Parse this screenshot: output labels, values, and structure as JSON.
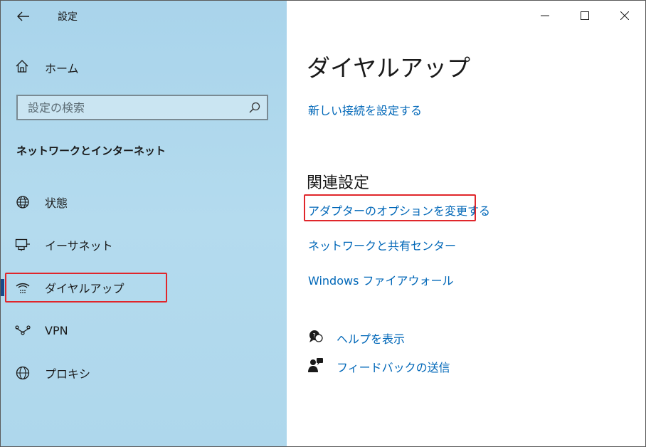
{
  "window": {
    "app_title": "設定",
    "controls": {
      "minimize": "—",
      "maximize": "☐",
      "close": "✕"
    }
  },
  "sidebar": {
    "home_label": "ホーム",
    "search_placeholder": "設定の検索",
    "section_title": "ネットワークとインターネット",
    "items": [
      {
        "label": "状態",
        "icon": "globe-status-icon"
      },
      {
        "label": "イーサネット",
        "icon": "ethernet-icon"
      },
      {
        "label": "ダイヤルアップ",
        "icon": "dialup-icon",
        "selected": true
      },
      {
        "label": "VPN",
        "icon": "vpn-icon"
      },
      {
        "label": "プロキシ",
        "icon": "globe-icon"
      }
    ]
  },
  "main": {
    "title": "ダイヤルアップ",
    "new_connection_link": "新しい接続を設定する",
    "related_title": "関連設定",
    "related_links": [
      "アダプターのオプションを変更する",
      "ネットワークと共有センター",
      "Windows ファイアウォール"
    ],
    "help": [
      {
        "label": "ヘルプを表示",
        "icon": "help-chat-icon"
      },
      {
        "label": "フィードバックの送信",
        "icon": "feedback-icon"
      }
    ]
  },
  "colors": {
    "accent": "#0067b8",
    "highlight": "#e0262b",
    "sidebar_bg": "#b0d8ec"
  }
}
